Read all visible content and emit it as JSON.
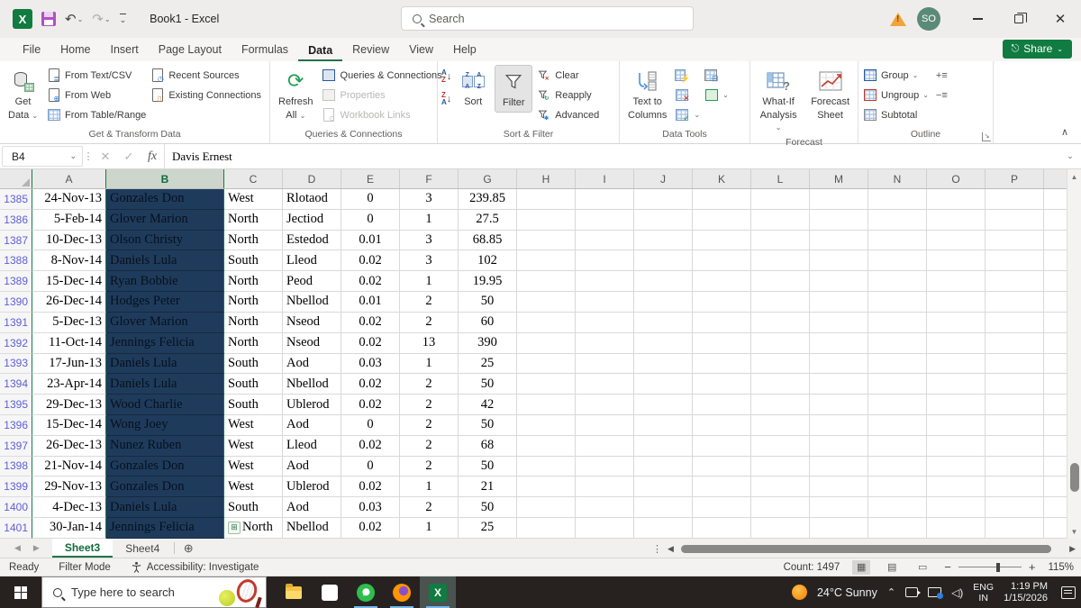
{
  "titlebar": {
    "title": "Book1 - Excel",
    "search_placeholder": "Search",
    "avatar_initials": "SO"
  },
  "ribbon": {
    "tabs": [
      "File",
      "Home",
      "Insert",
      "Page Layout",
      "Formulas",
      "Data",
      "Review",
      "View",
      "Help"
    ],
    "active_tab": "Data",
    "share_label": "Share",
    "get_transform": {
      "title": "Get & Transform Data",
      "get_data1": "Get",
      "get_data2": "Data",
      "from_text": "From Text/CSV",
      "from_web": "From Web",
      "from_table": "From Table/Range",
      "recent": "Recent Sources",
      "existing": "Existing Connections"
    },
    "queries": {
      "title": "Queries & Connections",
      "refresh1": "Refresh",
      "refresh2": "All",
      "qc": "Queries & Connections",
      "properties": "Properties",
      "links": "Workbook Links"
    },
    "sort_filter": {
      "title": "Sort & Filter",
      "sort": "Sort",
      "filter": "Filter",
      "clear": "Clear",
      "reapply": "Reapply",
      "advanced": "Advanced"
    },
    "data_tools": {
      "title": "Data Tools",
      "ttc1": "Text to",
      "ttc2": "Columns"
    },
    "forecast": {
      "title": "Forecast",
      "whatif1": "What-If",
      "whatif2": "Analysis",
      "fs1": "Forecast",
      "fs2": "Sheet"
    },
    "outline": {
      "title": "Outline",
      "group": "Group",
      "ungroup": "Ungroup",
      "subtotal": "Subtotal"
    }
  },
  "formula_bar": {
    "name_box": "B4",
    "value": "Davis Ernest"
  },
  "grid": {
    "columns": [
      "A",
      "B",
      "C",
      "D",
      "E",
      "F",
      "G",
      "H",
      "I",
      "J",
      "K",
      "L",
      "M",
      "N",
      "O",
      "P"
    ],
    "selected_column": "B",
    "first_row": 1385,
    "rows": [
      [
        "24-Nov-13",
        "Gonzales Don",
        "West",
        "Rlotaod",
        "0",
        "3",
        "239.85"
      ],
      [
        "5-Feb-14",
        "Glover Marion",
        "North",
        "Jectiod",
        "0",
        "1",
        "27.5"
      ],
      [
        "10-Dec-13",
        "Olson Christy",
        "North",
        "Estedod",
        "0.01",
        "3",
        "68.85"
      ],
      [
        "8-Nov-14",
        "Daniels Lula",
        "South",
        "Lleod",
        "0.02",
        "3",
        "102"
      ],
      [
        "15-Dec-14",
        "Ryan Bobbie",
        "North",
        "Peod",
        "0.02",
        "1",
        "19.95"
      ],
      [
        "26-Dec-14",
        "Hodges Peter",
        "North",
        "Nbellod",
        "0.01",
        "2",
        "50"
      ],
      [
        "5-Dec-13",
        "Glover Marion",
        "North",
        "Nseod",
        "0.02",
        "2",
        "60"
      ],
      [
        "11-Oct-14",
        "Jennings Felicia",
        "North",
        "Nseod",
        "0.02",
        "13",
        "390"
      ],
      [
        "17-Jun-13",
        "Daniels Lula",
        "South",
        "Aod",
        "0.03",
        "1",
        "25"
      ],
      [
        "23-Apr-14",
        "Daniels Lula",
        "South",
        "Nbellod",
        "0.02",
        "2",
        "50"
      ],
      [
        "29-Dec-13",
        "Wood Charlie",
        "South",
        "Ublerod",
        "0.02",
        "2",
        "42"
      ],
      [
        "15-Dec-14",
        "Wong Joey",
        "West",
        "Aod",
        "0",
        "2",
        "50"
      ],
      [
        "26-Dec-13",
        "Nunez Ruben",
        "West",
        "Lleod",
        "0.02",
        "2",
        "68"
      ],
      [
        "21-Nov-14",
        "Gonzales Don",
        "West",
        "Aod",
        "0",
        "2",
        "50"
      ],
      [
        "29-Nov-13",
        "Gonzales Don",
        "West",
        "Ublerod",
        "0.02",
        "1",
        "21"
      ],
      [
        "4-Dec-13",
        "Daniels Lula",
        "South",
        "Aod",
        "0.03",
        "2",
        "50"
      ],
      [
        "30-Jan-14",
        "Jennings Felicia",
        "North",
        "Nbellod",
        "0.02",
        "1",
        "25"
      ]
    ]
  },
  "sheet_tabs": {
    "tabs": [
      "Sheet3",
      "Sheet4"
    ],
    "active": "Sheet3"
  },
  "status_bar": {
    "ready": "Ready",
    "filter_mode": "Filter Mode",
    "accessibility": "Accessibility: Investigate",
    "count": "Count: 1497",
    "zoom": "115%"
  },
  "taskbar": {
    "search_placeholder": "Type here to search",
    "weather": "24°C Sunny",
    "lang_line1": "ENG",
    "lang_line2": "IN",
    "time": "1:19 PM",
    "date": "1/15/2026"
  },
  "colors": {
    "excel_green": "#107c41",
    "selection_fill": "#1f3b5c",
    "filter_row_number": "#5e5ed8"
  }
}
